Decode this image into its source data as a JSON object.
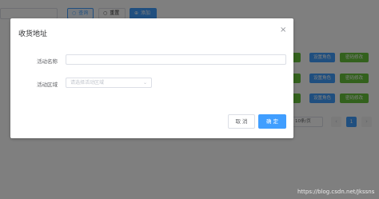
{
  "toolbar": {
    "query_label": "查询",
    "reset_label": "重置",
    "add_label": "添加",
    "query_icon": "search-icon",
    "reset_icon": "refresh-icon",
    "add_icon": "plus-icon"
  },
  "table": {
    "rows": [
      {
        "role_button": "设置角色",
        "password_button": "密码修改"
      },
      {
        "role_button": "设置角色",
        "password_button": "密码修改"
      },
      {
        "role_button": "设置角色",
        "password_button": "密码修改"
      }
    ]
  },
  "pagination": {
    "page_size": "10条/页",
    "current_page": "1",
    "prev_icon": "chevron-left-icon",
    "next_icon": "chevron-right-icon"
  },
  "dialog": {
    "title": "收货地址",
    "close_icon": "close-icon",
    "name_label": "活动名称",
    "name_value": "",
    "region_label": "活动区域",
    "region_placeholder": "请选择活动区域",
    "cancel_label": "取 消",
    "confirm_label": "确 定"
  },
  "watermark": "https://blog.csdn.net/Jkssns",
  "colors": {
    "primary": "#409eff",
    "success": "#67c23a",
    "mask": "rgba(0,0,0,0.5)"
  }
}
